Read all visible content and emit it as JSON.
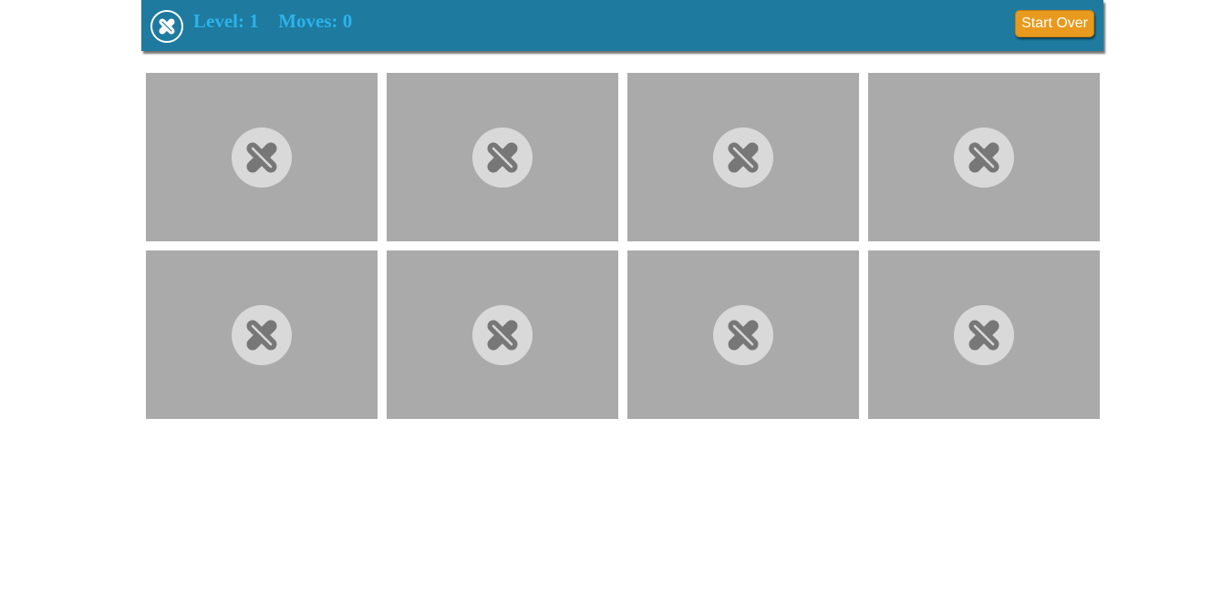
{
  "header": {
    "logo_icon": "x-logo-icon",
    "level_label": "Level:",
    "level_value": "1",
    "moves_label": "Moves:",
    "moves_value": "0",
    "start_over_label": "Start Over"
  },
  "colors": {
    "header_bg": "#1e7a9f",
    "stats_text": "#2bb3ea",
    "button_bg": "#e89a1e",
    "card_bg": "#aaaaaa",
    "card_icon_circle": "#d9d9d9",
    "card_icon_mark": "#777777"
  },
  "board": {
    "rows": 2,
    "columns": 4,
    "cards": [
      {
        "state": "face-down",
        "icon": "x-logo-icon"
      },
      {
        "state": "face-down",
        "icon": "x-logo-icon"
      },
      {
        "state": "face-down",
        "icon": "x-logo-icon"
      },
      {
        "state": "face-down",
        "icon": "x-logo-icon"
      },
      {
        "state": "face-down",
        "icon": "x-logo-icon"
      },
      {
        "state": "face-down",
        "icon": "x-logo-icon"
      },
      {
        "state": "face-down",
        "icon": "x-logo-icon"
      },
      {
        "state": "face-down",
        "icon": "x-logo-icon"
      }
    ]
  }
}
